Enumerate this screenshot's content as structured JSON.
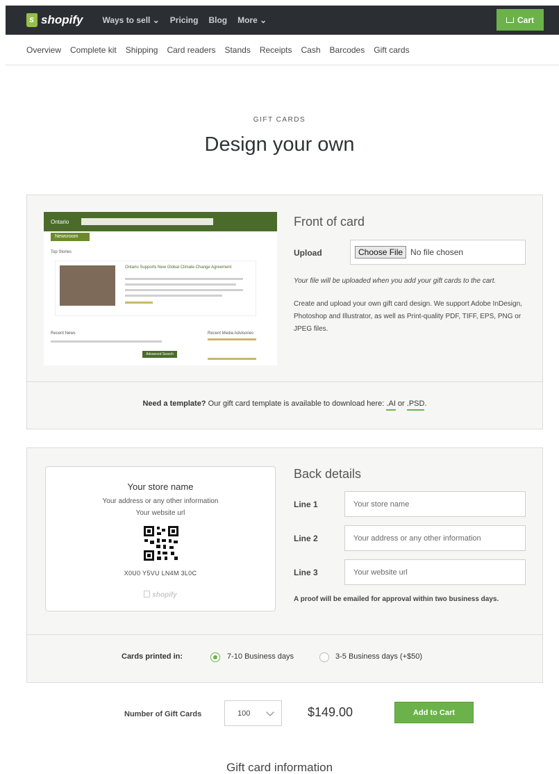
{
  "topbar": {
    "logo_text": "shopify",
    "nav": [
      "Ways to sell ⌄",
      "Pricing",
      "Blog",
      "More ⌄"
    ],
    "cart_label": "Cart"
  },
  "subnav": [
    "Overview",
    "Complete kit",
    "Shipping",
    "Card readers",
    "Stands",
    "Receipts",
    "Cash",
    "Barcodes",
    "Gift cards"
  ],
  "hero": {
    "eyebrow": "GIFT CARDS",
    "title": "Design your own"
  },
  "preview": {
    "site_name": "Ontario",
    "search_placeholder": "Search News",
    "tab": "Newsroom",
    "section": "Top Stories",
    "story_title": "Ontario Supports New Global Climate Change Agreement",
    "recent_news": "Recent News",
    "recent_advisories": "Recent Media Advisories",
    "advanced_search": "Advanced Search"
  },
  "front": {
    "title": "Front of card",
    "upload_label": "Upload",
    "choose_file": "Choose File",
    "no_file": "No file chosen",
    "upload_note": "Your file will be uploaded when you add your gift cards to the cart.",
    "description": "Create and upload your own gift card design. We support Adobe InDesign, Photoshop and Illustrator, as well as Print-quality PDF, TIFF, EPS, PNG or JPEG files.",
    "template_bold": "Need a template?",
    "template_text": " Our gift card template is available to download here: ",
    "template_ai": ".AI",
    "template_or": " or ",
    "template_psd": ".PSD",
    "template_end": "."
  },
  "back_card": {
    "store_name": "Your store name",
    "address": "Your address or any other information",
    "website": "Your website url",
    "code": "X0U0 Y5VU LN4M 3L0C",
    "logo": "shopify"
  },
  "back": {
    "title": "Back details",
    "lines": [
      {
        "label": "Line 1",
        "placeholder": "Your store name"
      },
      {
        "label": "Line 2",
        "placeholder": "Your address or any other information"
      },
      {
        "label": "Line 3",
        "placeholder": "Your website url"
      }
    ],
    "proof_note": "A proof will be emailed for approval within two business days.",
    "printed_label": "Cards printed in:",
    "options": [
      "7-10 Business days",
      "3-5 Business days (+$50)"
    ],
    "selected_option": 0
  },
  "order": {
    "qty_label": "Number of Gift Cards",
    "qty_value": "100",
    "price": "$149.00",
    "add_label": "Add to Cart"
  },
  "info_title": "Gift card information",
  "colors": {
    "brand": "#6cb24a",
    "nav_bg": "#2b2f33"
  }
}
